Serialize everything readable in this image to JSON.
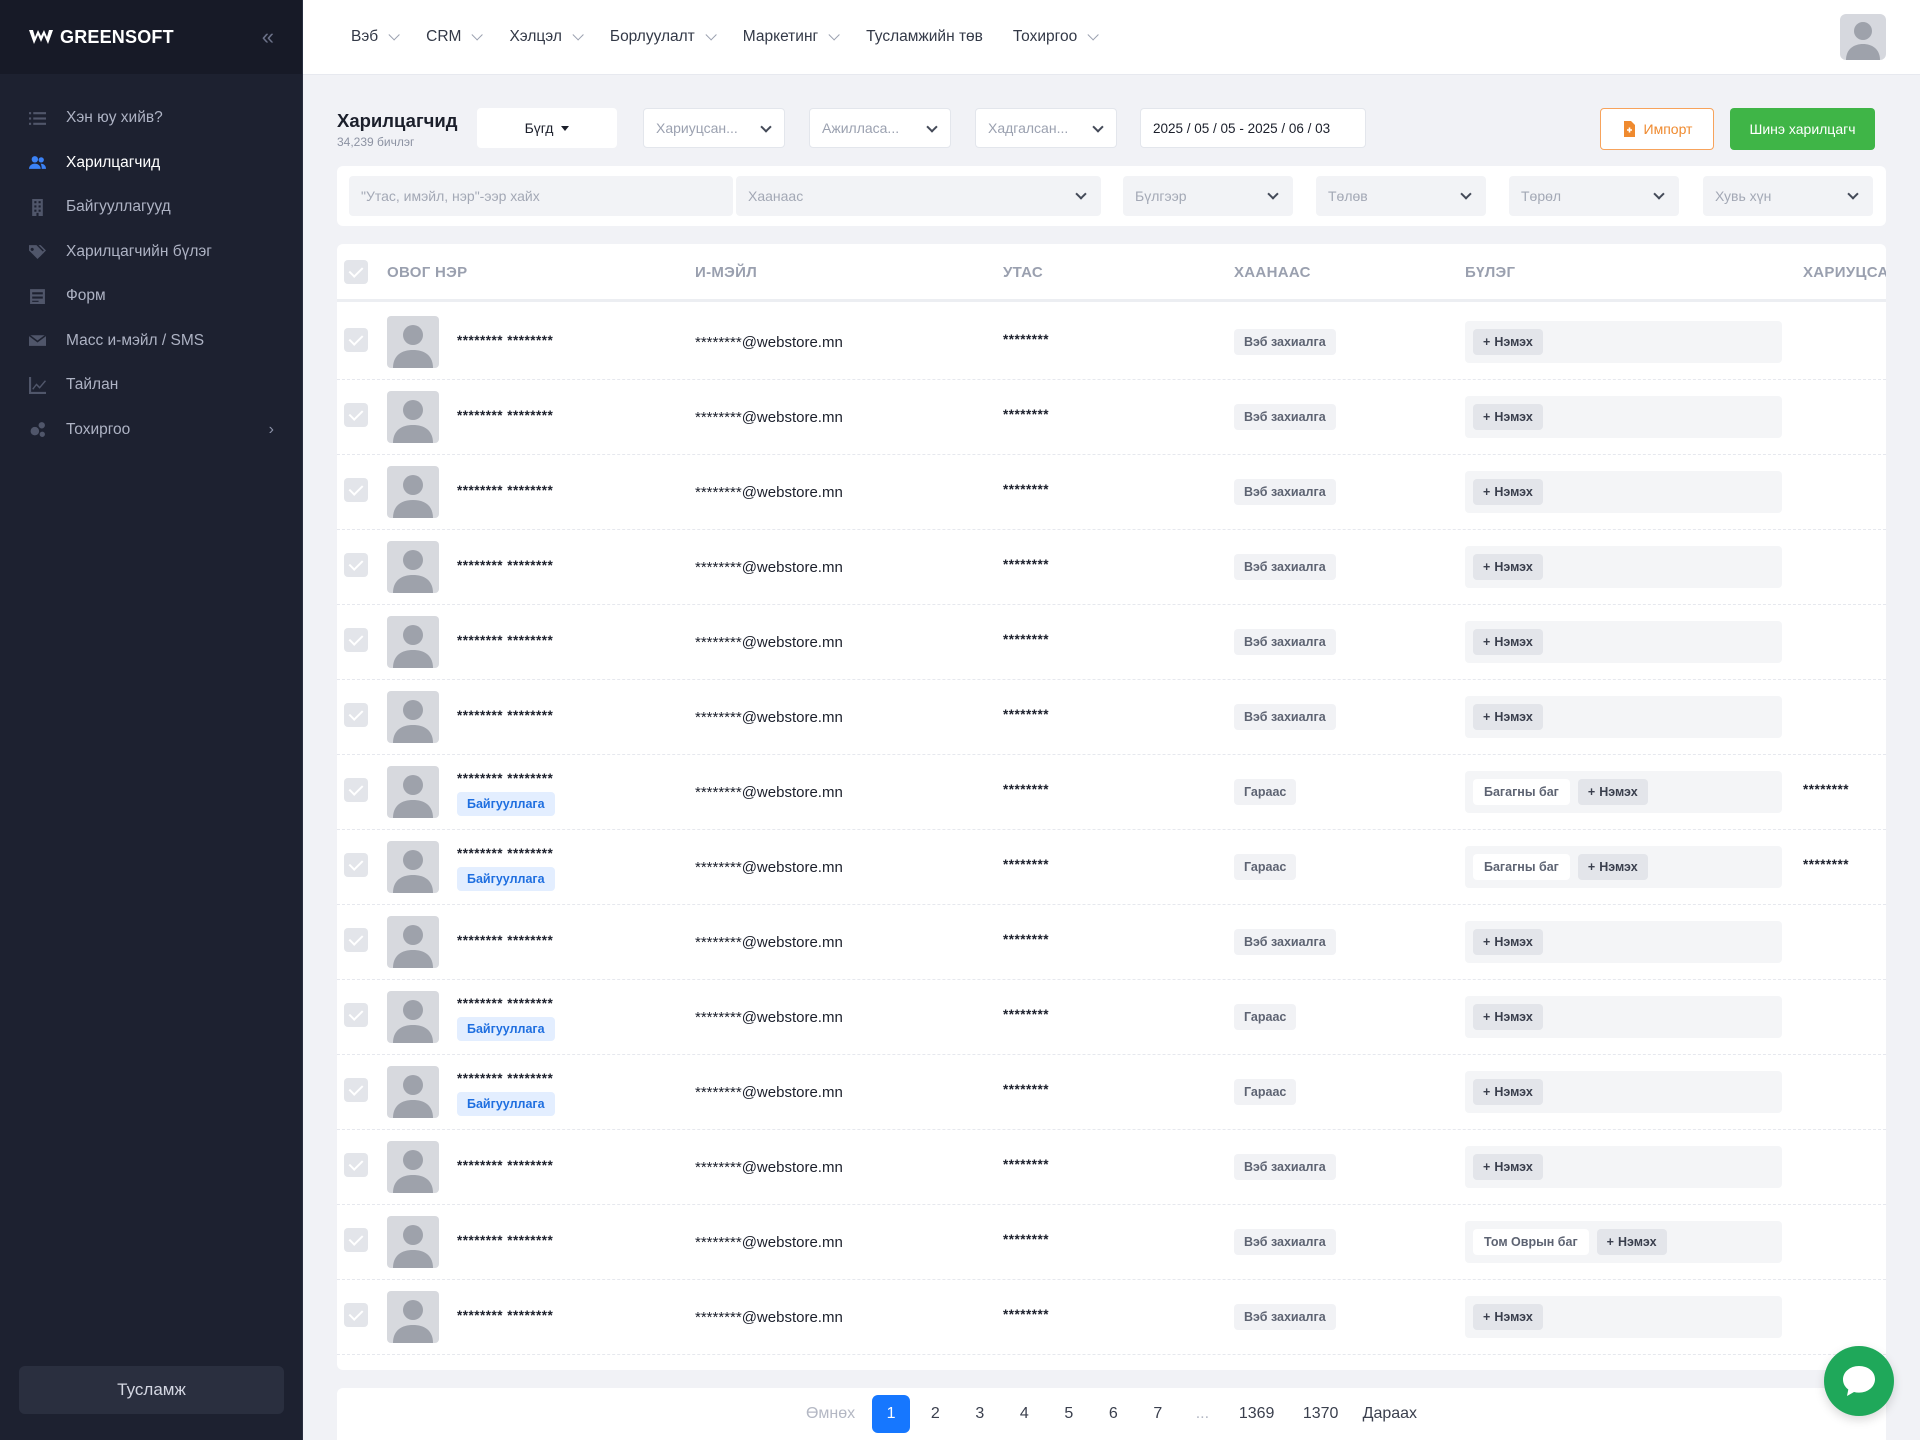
{
  "brand": {
    "name": "GREENSOFT"
  },
  "sidebar": {
    "items": [
      {
        "label": "Хэн юу хийв?",
        "icon": "list-icon"
      },
      {
        "label": "Харилцагчид",
        "icon": "users-icon",
        "active": true
      },
      {
        "label": "Байгууллагууд",
        "icon": "building-icon"
      },
      {
        "label": "Харилцагчийн бүлэг",
        "icon": "tags-icon"
      },
      {
        "label": "Форм",
        "icon": "form-icon"
      },
      {
        "label": "Масс и-мэйл / SMS",
        "icon": "envelope-icon"
      },
      {
        "label": "Тайлан",
        "icon": "chart-icon"
      },
      {
        "label": "Тохиргоо",
        "icon": "gears-icon"
      }
    ],
    "help_label": "Тусламж"
  },
  "topnav": {
    "items": [
      "Вэб",
      "CRM",
      "Хэлцэл",
      "Борлуулалт",
      "Маркетинг",
      "Тусламжийн төв",
      "Тохиргоо"
    ]
  },
  "page": {
    "title": "Харилцагчид",
    "subtitle": "34,239 бичлэг",
    "filter_all": "Бүгд",
    "filter_responsible": "Хариуцсан...",
    "filter_worked": "Ажилласа...",
    "filter_saved": "Хадгалсан...",
    "date_range": "2025 / 05 / 05 - 2025 / 06 / 03",
    "import_label": "Импорт",
    "new_label": "Шинэ харилцагч"
  },
  "search": {
    "placeholder": "\"Утас, имэйл, нэр\"-ээр хайх",
    "source": "Хаанаас",
    "group": "Бүлгээр",
    "status": "Төлөв",
    "type": "Төрөл",
    "person": "Хувь хүн"
  },
  "table": {
    "headers": [
      "ОВОГ НЭР",
      "И-МЭЙЛ",
      "УТАС",
      "ХААНААС",
      "БҮЛЭГ",
      "ХАРИУЦСА"
    ],
    "add_label": "Нэмэх",
    "org_label": "Байгууллага",
    "rows": [
      {
        "name": "******** ********",
        "email": "********@webstore.mn",
        "phone": "********",
        "source": "Вэб захиалга",
        "org": false,
        "tag": "",
        "resp": ""
      },
      {
        "name": "******** ********",
        "email": "********@webstore.mn",
        "phone": "********",
        "source": "Вэб захиалга",
        "org": false,
        "tag": "",
        "resp": ""
      },
      {
        "name": "******** ********",
        "email": "********@webstore.mn",
        "phone": "********",
        "source": "Вэб захиалга",
        "org": false,
        "tag": "",
        "resp": ""
      },
      {
        "name": "******** ********",
        "email": "********@webstore.mn",
        "phone": "********",
        "source": "Вэб захиалга",
        "org": false,
        "tag": "",
        "resp": ""
      },
      {
        "name": "******** ********",
        "email": "********@webstore.mn",
        "phone": "********",
        "source": "Вэб захиалга",
        "org": false,
        "tag": "",
        "resp": ""
      },
      {
        "name": "******** ********",
        "email": "********@webstore.mn",
        "phone": "********",
        "source": "Вэб захиалга",
        "org": false,
        "tag": "",
        "resp": ""
      },
      {
        "name": "******** ********",
        "email": "********@webstore.mn",
        "phone": "********",
        "source": "Гараас",
        "org": true,
        "tag": "Багагны баг",
        "resp": "********"
      },
      {
        "name": "******** ********",
        "email": "********@webstore.mn",
        "phone": "********",
        "source": "Гараас",
        "org": true,
        "tag": "Багагны баг",
        "resp": "********"
      },
      {
        "name": "******** ********",
        "email": "********@webstore.mn",
        "phone": "********",
        "source": "Вэб захиалга",
        "org": false,
        "tag": "",
        "resp": ""
      },
      {
        "name": "******** ********",
        "email": "********@webstore.mn",
        "phone": "********",
        "source": "Гараас",
        "org": true,
        "tag": "",
        "resp": ""
      },
      {
        "name": "******** ********",
        "email": "********@webstore.mn",
        "phone": "********",
        "source": "Гараас",
        "org": true,
        "tag": "",
        "resp": ""
      },
      {
        "name": "******** ********",
        "email": "********@webstore.mn",
        "phone": "********",
        "source": "Вэб захиалга",
        "org": false,
        "tag": "",
        "resp": ""
      },
      {
        "name": "******** ********",
        "email": "********@webstore.mn",
        "phone": "********",
        "source": "Вэб захиалга",
        "org": false,
        "tag": "Том Оврын баг",
        "resp": ""
      },
      {
        "name": "******** ********",
        "email": "********@webstore.mn",
        "phone": "********",
        "source": "Вэб захиалга",
        "org": false,
        "tag": "",
        "resp": ""
      }
    ]
  },
  "pagination": {
    "prev": "Өмнөх",
    "pages": [
      "1",
      "2",
      "3",
      "4",
      "5",
      "6",
      "7"
    ],
    "ellipsis": "...",
    "last_pages": [
      "1369",
      "1370"
    ],
    "next": "Дараах",
    "current": "1"
  },
  "colors": {
    "accent_blue": "#1677ff",
    "accent_green": "#3fb547",
    "import_orange": "#ef8a2f",
    "sidebar_bg": "#1d2130"
  }
}
